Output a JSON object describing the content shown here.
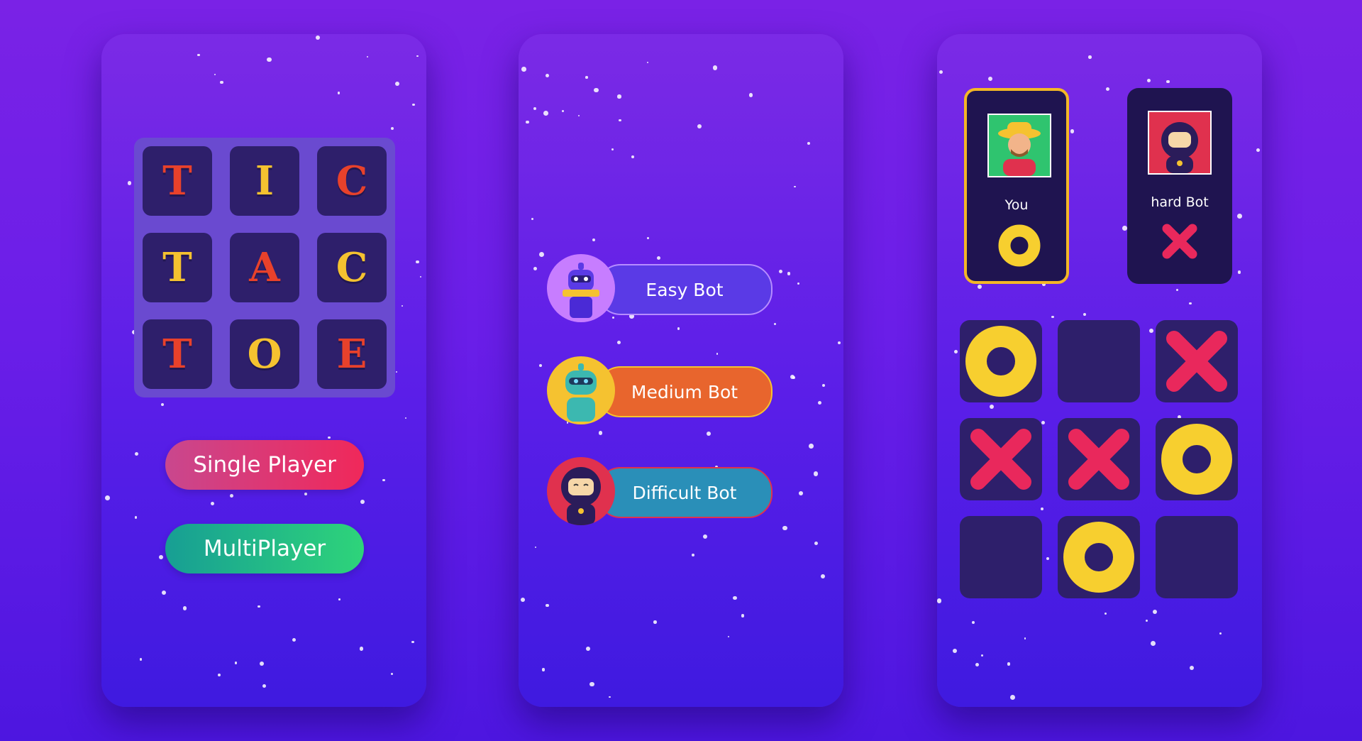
{
  "menu_screen": {
    "title_tiles": [
      "T",
      "I",
      "C",
      "T",
      "A",
      "C",
      "T",
      "O",
      "E"
    ],
    "tile_colors": [
      "#e8412b",
      "#f5c230",
      "#e8412b",
      "#f5c230",
      "#e8412b",
      "#f5c230",
      "#e8412b",
      "#f5c230",
      "#e8412b"
    ],
    "single_player_label": "Single Player",
    "multiplayer_label": "MultiPlayer"
  },
  "bot_screen": {
    "bots": [
      {
        "label": "Easy Bot",
        "color": "#5a3ae6",
        "border": "#b68cff",
        "avatar": "robot-purple-avatar"
      },
      {
        "label": "Medium Bot",
        "color": "#e8652d",
        "border": "#f5c230",
        "avatar": "robot-teal-avatar"
      },
      {
        "label": "Difficult Bot",
        "color": "#2a8fb8",
        "border": "#e0314e",
        "avatar": "robot-red-avatar"
      }
    ]
  },
  "game_screen": {
    "players": [
      {
        "name": "You",
        "mark": "O",
        "active": true
      },
      {
        "name": "hard Bot",
        "mark": "X",
        "active": false
      }
    ],
    "board": [
      "O",
      "",
      "X",
      "X",
      "X",
      "O",
      "",
      "O",
      ""
    ],
    "colors": {
      "o": "#f7cf2f",
      "x": "#e9285c",
      "active_border": "#f4b726"
    }
  }
}
